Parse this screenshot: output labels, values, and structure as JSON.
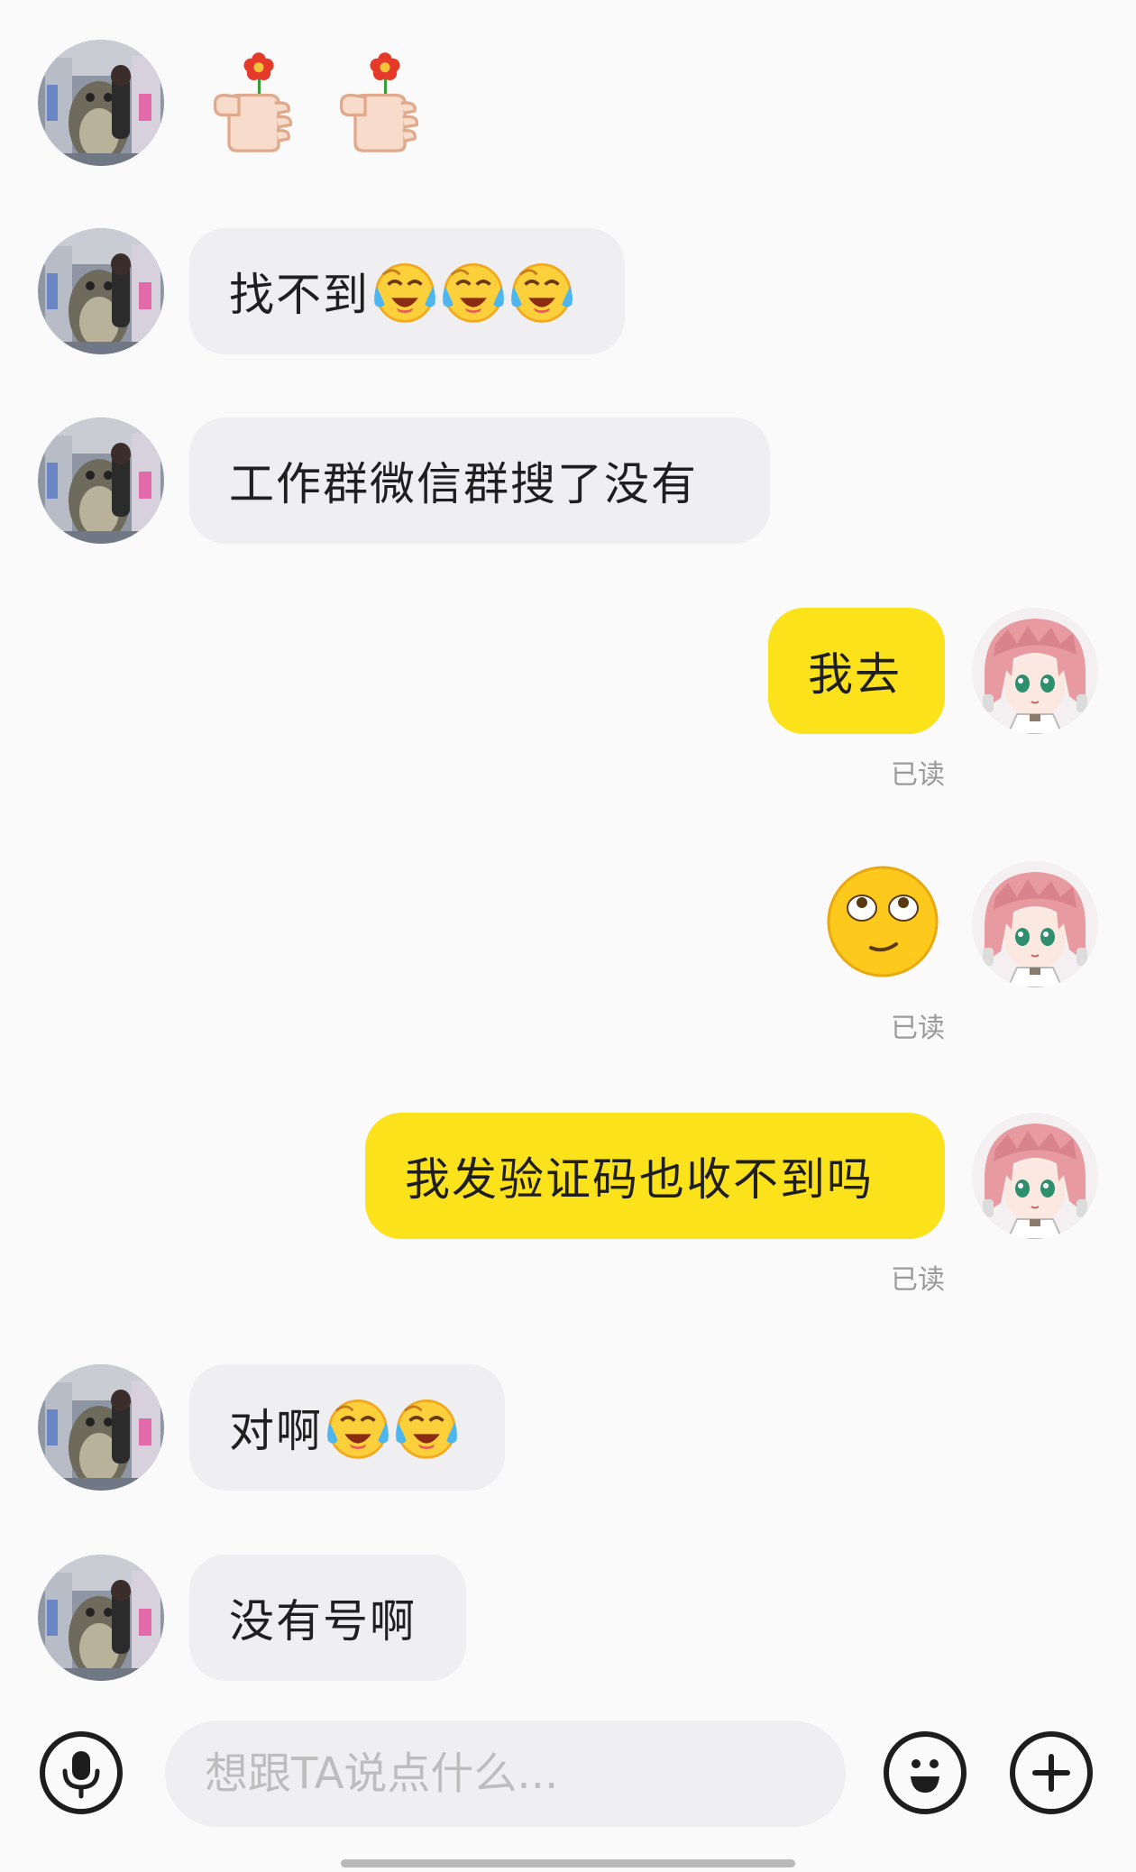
{
  "messages": [
    {
      "side": "in",
      "kind": "sticker",
      "stickers": [
        "thumb-flower-icon",
        "thumb-flower-icon"
      ]
    },
    {
      "side": "in",
      "kind": "text",
      "text": "找不到",
      "emojis": [
        "crying-laugh-icon",
        "crying-laugh-icon",
        "crying-laugh-icon"
      ]
    },
    {
      "side": "in",
      "kind": "text",
      "text": "工作群微信群搜了没有",
      "emojis": []
    },
    {
      "side": "out",
      "kind": "text",
      "text": "我去",
      "emojis": [],
      "status": "已读"
    },
    {
      "side": "out",
      "kind": "sticker",
      "stickers": [
        "rolling-eyes-icon"
      ],
      "status": "已读"
    },
    {
      "side": "out",
      "kind": "text",
      "text": "我发验证码也收不到吗",
      "emojis": [],
      "status": "已读"
    },
    {
      "side": "in",
      "kind": "text",
      "text": "对啊",
      "emojis": [
        "crying-laugh-icon",
        "crying-laugh-icon"
      ]
    },
    {
      "side": "in",
      "kind": "text",
      "text": "没有号啊",
      "emojis": []
    }
  ],
  "input": {
    "placeholder": "想跟TA说点什么..."
  },
  "icons": {
    "voice": "microphone-icon",
    "emoji": "smiley-icon",
    "more": "plus-icon"
  },
  "colors": {
    "outgoing_bubble": "#fbe21a",
    "incoming_bubble": "#efeff1",
    "background": "#fafafa"
  }
}
